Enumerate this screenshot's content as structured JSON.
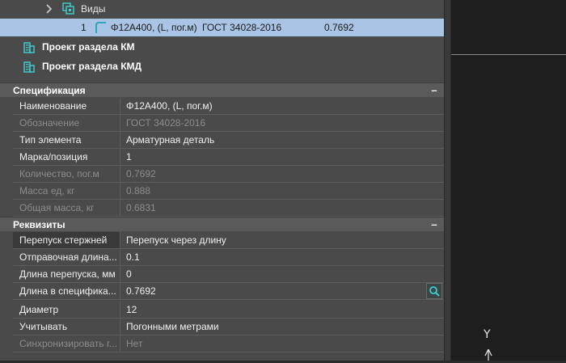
{
  "tree": {
    "vidy_label": "Виды",
    "selected_row": {
      "index": "1",
      "name": "Φ12А400, (L, пог.м)",
      "standard": "ГОСТ 34028-2016",
      "value": "0.7692"
    },
    "project_km_label": "Проект раздела КМ",
    "project_kmd_label": "Проект раздела КМД"
  },
  "sections": {
    "spec_title": "Спецификация",
    "req_title": "Реквизиты",
    "collapse_symbol": "–"
  },
  "specification": [
    {
      "key": "Наименование",
      "value": "Φ12А400, (L, пог.м)",
      "disabled": false
    },
    {
      "key": "Обозначение",
      "value": "ГОСТ 34028-2016",
      "disabled": true
    },
    {
      "key": "Тип элемента",
      "value": "Арматурная деталь",
      "disabled": false
    },
    {
      "key": "Марка/позиция",
      "value": "1",
      "disabled": false
    },
    {
      "key": "Количество, пог.м",
      "value": "0.7692",
      "disabled": true
    },
    {
      "key": "Масса ед, кг",
      "value": "0.888",
      "disabled": true
    },
    {
      "key": "Общая масса, кг",
      "value": "0.6831",
      "disabled": true
    }
  ],
  "requisites": [
    {
      "key": "Перепуск стержней",
      "value": "Перепуск через длину",
      "disabled": false
    },
    {
      "key": "Отправочная длина...",
      "value": "0.1",
      "disabled": false
    },
    {
      "key": "Длина перепуска, мм",
      "value": "0",
      "disabled": false
    },
    {
      "key": "Длина в специфика...",
      "value": "0.7692",
      "disabled": false
    },
    {
      "key": "Диаметр",
      "value": "12",
      "disabled": false
    },
    {
      "key": "Учитывать",
      "value": "Погонными метрами",
      "disabled": false
    },
    {
      "key": "Синхронизировать г...",
      "value": "Нет",
      "disabled": true
    }
  ],
  "viewport": {
    "axis_label": "Y"
  },
  "colors": {
    "accent": "#3fd0d0",
    "selection": "#a9c4e4"
  }
}
